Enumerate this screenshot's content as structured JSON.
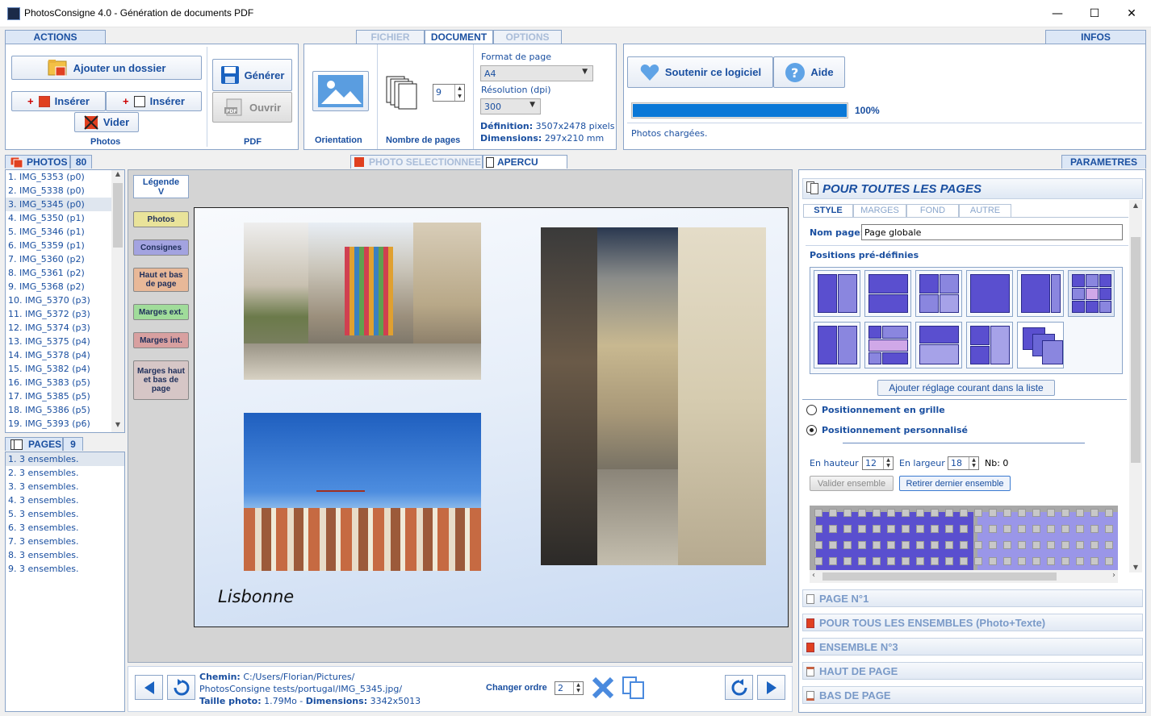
{
  "window": {
    "title": "PhotosConsigne 4.0 - Génération de documents PDF",
    "min": "—",
    "max": "☐",
    "close": "✕"
  },
  "tabs": {
    "actions": "ACTIONS",
    "fichier": "FICHIER",
    "document": "DOCUMENT",
    "options": "OPTIONS",
    "infos": "INFOS"
  },
  "actions": {
    "add_folder": "Ajouter un dossier",
    "insert1": "Insérer",
    "insert2": "Insérer",
    "clear": "Vider",
    "photos_label": "Photos",
    "generate": "Générer",
    "open": "Ouvrir",
    "pdf_label": "PDF"
  },
  "document": {
    "orientation_label": "Orientation",
    "pages_label": "Nombre de pages",
    "pages_value": "9",
    "format_label": "Format de page",
    "format_value": "A4",
    "resolution_label": "Résolution (dpi)",
    "resolution_value": "300",
    "definition_label": "Définition:",
    "definition_value": "3507x2478 pixels",
    "dimensions_label": "Dimensions:",
    "dimensions_value": "297x210 mm"
  },
  "infos": {
    "support": "Soutenir ce logiciel",
    "help": "Aide",
    "progress": 1.0,
    "progress_label": "100%",
    "status": "Photos chargées."
  },
  "photos": {
    "header": "PHOTOS",
    "count": "80",
    "items": [
      "1. IMG_5353 (p0)",
      "2. IMG_5338 (p0)",
      "3. IMG_5345 (p0)",
      "4. IMG_5350 (p1)",
      "5. IMG_5346 (p1)",
      "6. IMG_5359 (p1)",
      "7. IMG_5360 (p2)",
      "8. IMG_5361 (p2)",
      "9. IMG_5368 (p2)",
      "10. IMG_5370 (p3)",
      "11. IMG_5372 (p3)",
      "12. IMG_5374 (p3)",
      "13. IMG_5375 (p4)",
      "14. IMG_5378 (p4)",
      "15. IMG_5382 (p4)",
      "16. IMG_5383 (p5)",
      "17. IMG_5385 (p5)",
      "18. IMG_5386 (p5)",
      "19. IMG_5393 (p6)"
    ]
  },
  "pages": {
    "header": "PAGES",
    "count": "9",
    "items": [
      "1. 3 ensembles.",
      "2. 3 ensembles.",
      "3. 3 ensembles.",
      "4. 3 ensembles.",
      "5. 3 ensembles.",
      "6. 3 ensembles.",
      "7. 3 ensembles.",
      "8. 3 ensembles.",
      "9. 3 ensembles."
    ]
  },
  "preview": {
    "tab_photo": "PHOTO SELECTIONNEE",
    "tab_apercu": "APERCU PAGE",
    "legend_title": "Légende",
    "legend_sub": "V",
    "legend": [
      "Photos",
      "Consignes",
      "Haut et bas de page",
      "Marges ext.",
      "Marges int.",
      "Marges haut et bas de page"
    ],
    "caption": "Lisbonne"
  },
  "bottom": {
    "path_label": "Chemin:",
    "path_value1": "C:/Users/Florian/Pictures/",
    "path_value2": "PhotosConsigne tests/portugal/IMG_5345.jpg/",
    "size_label": "Taille photo:",
    "size_value": "1.79Mo",
    "dim_label": "Dimensions:",
    "dim_value": "3342x5013",
    "order_label": "Changer ordre",
    "order_value": "2"
  },
  "params": {
    "tab": "PARAMETRES",
    "section_title": "POUR TOUTES LES PAGES",
    "subtabs": [
      "STYLE",
      "MARGES",
      "FOND",
      "AUTRE"
    ],
    "nom_label": "Nom page:",
    "nom_value": "Page globale",
    "positions_label": "Positions pré-définies",
    "add_setting": "Ajouter réglage courant dans la liste",
    "grid_radio": "Positionnement en grille",
    "custom_radio": "Positionnement personnalisé",
    "height_label": "En hauteur",
    "height_value": "12",
    "width_label": "En largeur",
    "width_value": "18",
    "nb_label": "Nb: 0",
    "validate": "Valider ensemble",
    "remove": "Retirer dernier ensemble",
    "sections": [
      "PAGE N°1",
      "POUR TOUS LES ENSEMBLES (Photo+Texte)",
      "ENSEMBLE N°3",
      "HAUT DE PAGE",
      "BAS DE PAGE"
    ]
  },
  "colors": {
    "accent": "#1a4fa0",
    "preset_fill": "#5a4fcf",
    "progress": "#0a78d7"
  }
}
